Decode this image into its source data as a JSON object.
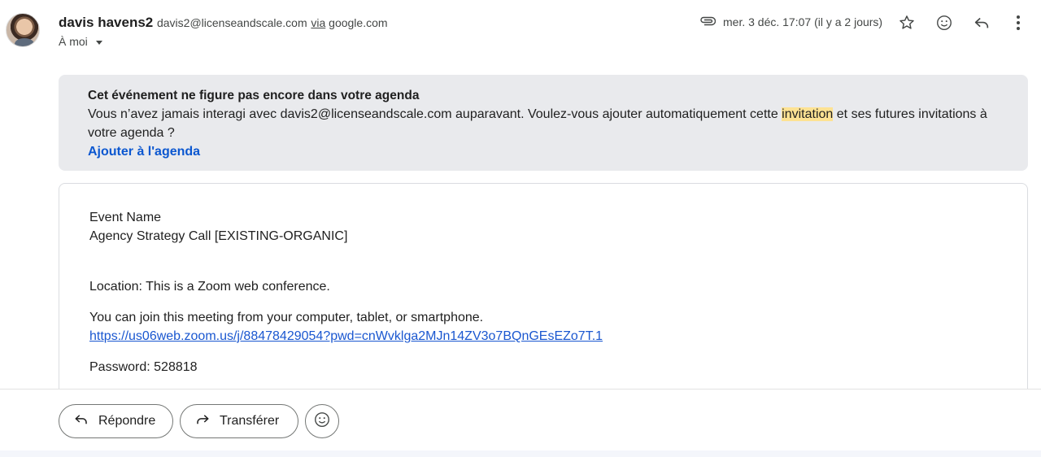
{
  "sender": {
    "name": "davis havens2",
    "email": "davis2@licenseandscale.com",
    "via_label": "via",
    "via_domain": "google.com",
    "to_label": "À moi"
  },
  "meta": {
    "date": "mer. 3 déc. 17:07 (il y a 2 jours)"
  },
  "icons": {
    "attachment": "paperclip-icon",
    "star": "star-icon",
    "emoji": "emoji-reaction-icon",
    "reply": "reply-icon",
    "more": "more-vert-icon"
  },
  "banner": {
    "title": "Cet événement ne figure pas encore dans votre agenda",
    "text_before": "Vous n’avez jamais interagi avec davis2@licenseandscale.com auparavant. Voulez-vous ajouter automatiquement cette ",
    "highlight": "invitation",
    "text_after": " et ses futures invitations à votre agenda ?",
    "action": "Ajouter à l'agenda"
  },
  "body": {
    "event_name_label": "Event Name",
    "event_name_value": "Agency Strategy Call [EXISTING-ORGANIC]",
    "location": "Location: This is a Zoom web conference.",
    "join_text": "You can join this meeting from your computer, tablet, or smartphone.",
    "join_link": "https://us06web.zoom.us/j/88478429054?pwd=cnWvklga2MJn14ZV3o7BQnGEsEZo7T.1",
    "password": "Password: 528818"
  },
  "footer": {
    "reply_label": "Répondre",
    "forward_label": "Transférer"
  }
}
